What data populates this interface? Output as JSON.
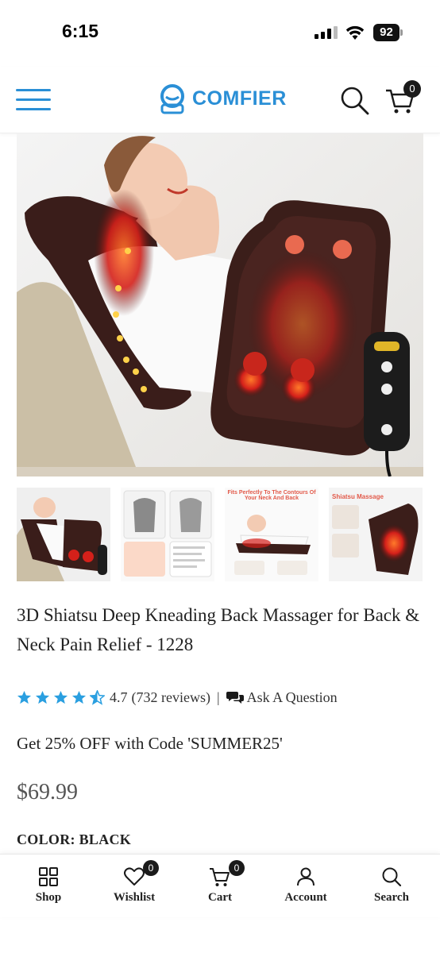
{
  "status_bar": {
    "time": "6:15",
    "battery": "92"
  },
  "header": {
    "logo_text": "COMFIER",
    "cart_count": "0",
    "menu_icon": "hamburger-menu-icon",
    "search_icon": "search-icon",
    "cart_icon": "cart-icon"
  },
  "product": {
    "title": "3D Shiatsu Deep Kneading Back Massager for Back & Neck Pain Relief - 1228",
    "rating": "4.7",
    "reviews": "(732 reviews)",
    "separator": "|",
    "ask_question": "Ask A Question",
    "promo": "Get 25% OFF with Code 'SUMMER25'",
    "price": "$69.99",
    "color_label": "COLOR: BLACK",
    "stars_filled": 4.5
  },
  "thumbnails": [
    {
      "caption": ""
    },
    {
      "caption": ""
    },
    {
      "caption": "Fits Perfectly To The Contours Of Your Neck And Back"
    },
    {
      "caption": "Shiatsu Massage"
    }
  ],
  "bottom_nav": [
    {
      "label": "Shop",
      "icon": "grid-icon"
    },
    {
      "label": "Wishlist",
      "icon": "heart-icon",
      "badge": "0"
    },
    {
      "label": "Cart",
      "icon": "cart-icon",
      "badge": "0"
    },
    {
      "label": "Account",
      "icon": "user-icon"
    },
    {
      "label": "Search",
      "icon": "search-icon"
    }
  ],
  "colors": {
    "brand": "#2a8fd6",
    "star": "#2a9fe0",
    "badge": "#1a1a1a"
  }
}
